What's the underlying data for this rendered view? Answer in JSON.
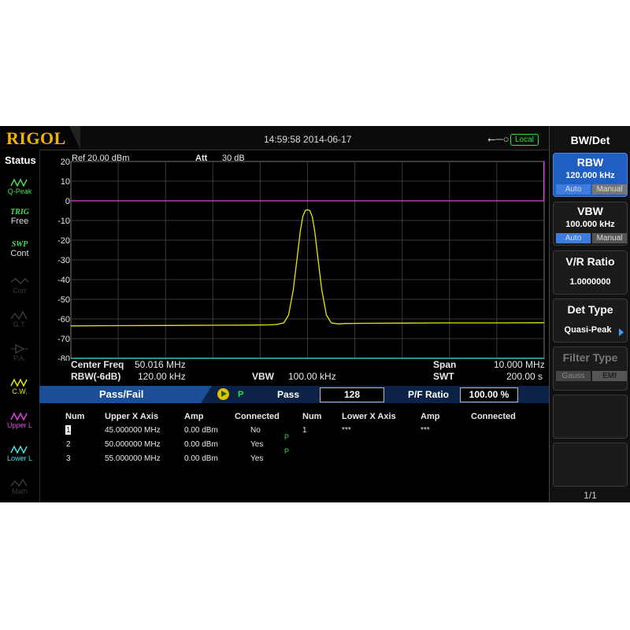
{
  "brand": "RIGOL",
  "topbar": {
    "datetime": "14:59:58  2014-06-17",
    "usb_icon": "usb-icon",
    "local_label": "Local"
  },
  "status": {
    "title": "Status",
    "items": [
      {
        "label": "Q-Peak",
        "color": "#3fe04a",
        "icon": "qpeak-icon"
      },
      {
        "label": "TRIG",
        "sub": "Free",
        "color": "#3fe04a"
      },
      {
        "label": "SWP",
        "sub": "Cont",
        "color": "#3fe04a"
      },
      {
        "label": "Corr",
        "color": "#3a3a3a",
        "icon": "corr-icon"
      },
      {
        "label": "G.T.",
        "color": "#3a3a3a",
        "icon": "gt-icon"
      },
      {
        "label": "P.A.",
        "color": "#3a3a3a",
        "icon": "pa-icon"
      },
      {
        "label": "C.W.",
        "color": "#e6e600",
        "icon": "cw-icon"
      },
      {
        "label": "Upper L",
        "color": "#e040e0",
        "icon": "upper-limit-icon"
      },
      {
        "label": "Lower L",
        "color": "#40e0e0",
        "icon": "lower-limit-icon"
      },
      {
        "label": "Math",
        "color": "#3a3a3a",
        "icon": "math-icon"
      }
    ]
  },
  "chart_data": {
    "type": "line",
    "ref_label": "Ref  20.00 dBm",
    "att_label": "Att",
    "att_value": "30 dB",
    "ylim": [
      -80,
      20
    ],
    "y_ticks": [
      "20",
      "10",
      "0",
      "-10",
      "-20",
      "-30",
      "-40",
      "-50",
      "-60",
      "-70",
      "-80"
    ],
    "x_divisions": 10,
    "series": [
      {
        "role": "trace",
        "color": "#e6e600",
        "x": [
          0,
          1.0,
          2.0,
          3.0,
          3.8,
          4.2,
          4.35,
          4.5,
          4.6,
          4.7,
          4.8,
          4.85,
          4.9,
          4.95,
          5.0,
          5.05,
          5.1,
          5.15,
          5.2,
          5.3,
          5.4,
          5.5,
          5.65,
          5.8,
          6.2,
          7.0,
          8.0,
          9.0,
          10.0
        ],
        "y": [
          -63.5,
          -63.4,
          -63.3,
          -63.2,
          -63.1,
          -63,
          -62.8,
          -62,
          -58,
          -45,
          -25,
          -15,
          -8,
          -5,
          -4.5,
          -5,
          -8,
          -15,
          -25,
          -45,
          -58,
          -62,
          -62.5,
          -62.3,
          -62.2,
          -62.1,
          -62,
          -62,
          -61.9
        ]
      },
      {
        "role": "upper-limit",
        "color": "#e040e0",
        "x": [
          0,
          10
        ],
        "y": [
          0,
          0
        ]
      },
      {
        "role": "lower-limit",
        "color": "#40e0e0",
        "x": [
          0,
          10
        ],
        "y": [
          -80,
          -80
        ]
      }
    ],
    "center_freq_label": "Center Freq",
    "center_freq": "50.016 MHz",
    "span_label": "Span",
    "span": "10.000 MHz",
    "rbw_label": "RBW(-6dB)",
    "rbw": "120.00 kHz",
    "vbw_label": "VBW",
    "vbw": "100.00 kHz",
    "swt_label": "SWT",
    "swt": "200.00 s"
  },
  "passfail": {
    "tab_label": "Pass/Fail",
    "state": "P",
    "pass_label": "Pass",
    "pass_count": "128",
    "ratio_label": "P/F Ratio",
    "ratio_value": "100.00 %"
  },
  "table": {
    "upper_headers": [
      "Num",
      "Upper X Axis",
      "Amp",
      "Connected"
    ],
    "lower_headers": [
      "Num",
      "Lower X Axis",
      "Amp",
      "Connected"
    ],
    "upper_rows": [
      {
        "num": "1",
        "x": "45.000000 MHz",
        "amp": "0.00 dBm",
        "connected": "No"
      },
      {
        "num": "2",
        "x": "50.000000 MHz",
        "amp": "0.00 dBm",
        "connected": "Yes"
      },
      {
        "num": "3",
        "x": "55.000000 MHz",
        "amp": "0.00 dBm",
        "connected": "Yes"
      }
    ],
    "lower_rows": [
      {
        "num": "1",
        "x": "***",
        "amp": "***",
        "connected": ""
      }
    ],
    "segment_marks": [
      "P",
      "P"
    ]
  },
  "menu": {
    "title": "BW/Det",
    "keys": [
      {
        "title": "RBW",
        "value": "120.000 kHz",
        "opt_a": "Auto",
        "opt_b": "Manual"
      },
      {
        "title": "VBW",
        "value": "100.000 kHz",
        "opt_a": "Auto",
        "opt_b": "Manual"
      },
      {
        "title": "V/R Ratio",
        "value": "1.0000000"
      },
      {
        "title": "Det Type",
        "value": "Quasi-Peak"
      },
      {
        "title": "Filter Type",
        "opt_a": "Gauss",
        "opt_b": "EMI"
      }
    ],
    "page": "1/1"
  }
}
